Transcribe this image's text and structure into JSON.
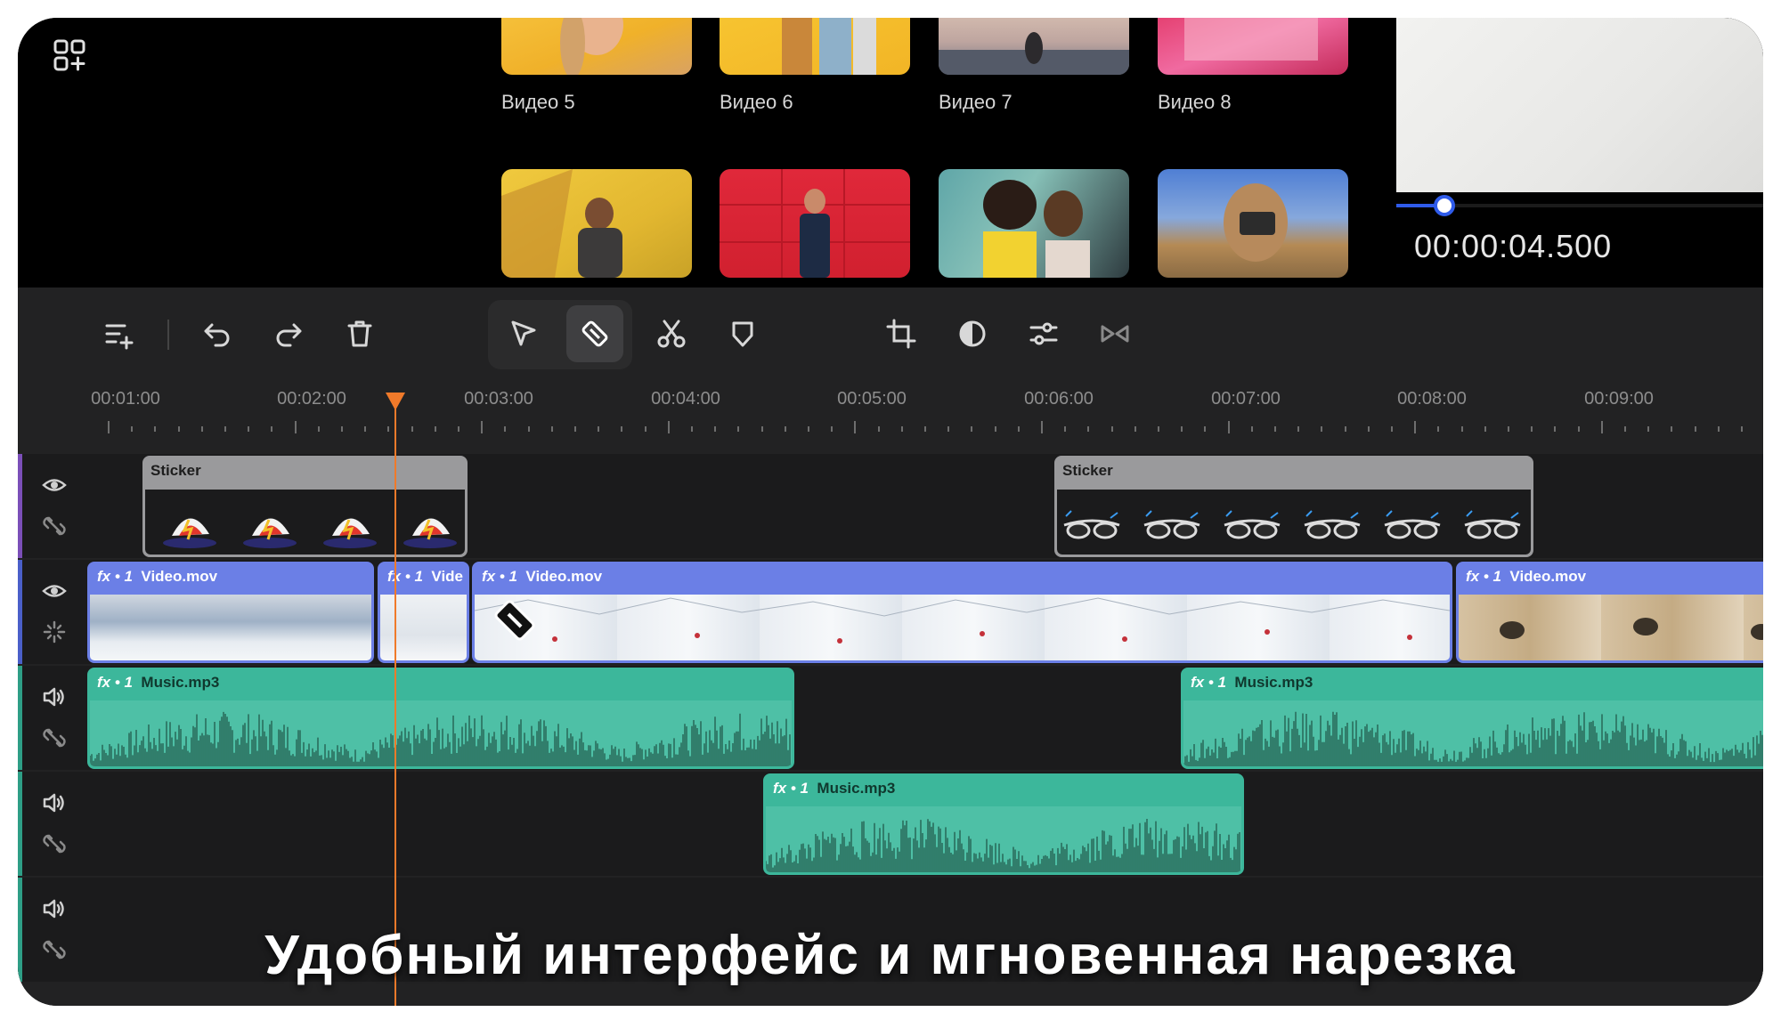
{
  "library": {
    "icon": "add-media-grid-icon",
    "top_row": [
      {
        "label": "Видео 5"
      },
      {
        "label": "Видео 6"
      },
      {
        "label": "Видео 7"
      },
      {
        "label": "Видео 8"
      }
    ],
    "bottom_row": [
      {
        "label": ""
      },
      {
        "label": ""
      },
      {
        "label": ""
      },
      {
        "label": ""
      }
    ]
  },
  "preview": {
    "timecode": "00:00:04.500",
    "progress": 0.13,
    "accent": "#2f5bea"
  },
  "toolbar": {
    "tools": [
      {
        "name": "add-track-icon"
      },
      {
        "name": "undo-icon"
      },
      {
        "name": "redo-icon"
      },
      {
        "name": "delete-icon"
      },
      {
        "name": "select-pointer-icon"
      },
      {
        "name": "blade-tool-icon",
        "active": true
      },
      {
        "name": "scissors-icon"
      },
      {
        "name": "shield-icon"
      },
      {
        "name": "crop-icon"
      },
      {
        "name": "color-icon"
      },
      {
        "name": "adjust-sliders-icon"
      },
      {
        "name": "transition-icon"
      }
    ]
  },
  "ruler": {
    "labels": [
      "00:01:00",
      "00:02:00",
      "00:03:00",
      "00:04:00",
      "00:05:00",
      "00:06:00",
      "00:07:00",
      "00:08:00",
      "00:09:00"
    ]
  },
  "tracks": {
    "sticker_track": {
      "clips": [
        {
          "title": "Sticker"
        },
        {
          "title": "Sticker"
        }
      ]
    },
    "video_track": {
      "clips": [
        {
          "badge": "fx • 1",
          "title": "Video.mov"
        },
        {
          "badge": "fx • 1",
          "title": "Vide"
        },
        {
          "badge": "fx • 1",
          "title": "Video.mov"
        },
        {
          "badge": "fx • 1",
          "title": "Video.mov"
        }
      ]
    },
    "audio_track_1": {
      "clips": [
        {
          "badge": "fx • 1",
          "title": "Music.mp3"
        },
        {
          "badge": "fx • 1",
          "title": "Music.mp3"
        }
      ]
    },
    "audio_track_2": {
      "clips": [
        {
          "badge": "fx • 1",
          "title": "Music.mp3"
        }
      ]
    }
  },
  "colors": {
    "video_clip": "#6b7fe6",
    "audio_clip": "#3cb79b",
    "sticker_clip": "#9a9a9c",
    "playhead": "#f07a2a"
  },
  "caption": "Удобный интерфейс и мгновенная нарезка"
}
